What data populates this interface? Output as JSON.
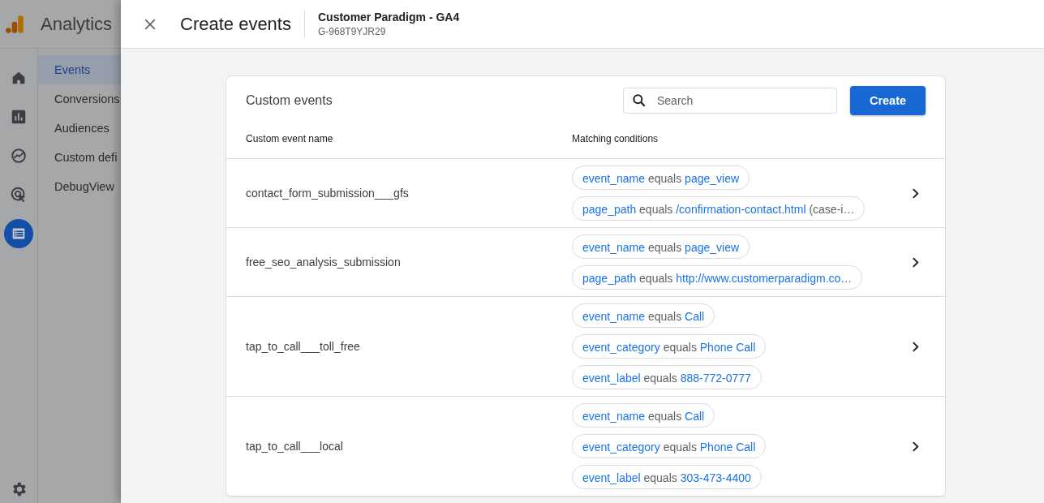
{
  "app": {
    "title": "Analytics",
    "rail": [
      {
        "selected": false
      },
      {
        "selected": false
      },
      {
        "selected": false
      },
      {
        "selected": false
      },
      {
        "selected": true
      }
    ],
    "nav": [
      {
        "label": "Events",
        "selected": true
      },
      {
        "label": "Conversions",
        "selected": false
      },
      {
        "label": "Audiences",
        "selected": false
      },
      {
        "label": "Custom defi",
        "selected": false
      },
      {
        "label": "DebugView",
        "selected": false
      }
    ]
  },
  "panel": {
    "title": "Create events",
    "property": "Customer Paradigm - GA4",
    "property_id": "G-968T9YJR29"
  },
  "card": {
    "title": "Custom events",
    "search": {
      "placeholder": "Search"
    },
    "create_button": "Create",
    "columns": [
      "Custom event name",
      "Matching conditions"
    ],
    "rows": [
      {
        "name": "contact_form_submission___gfs",
        "conditions": [
          {
            "field": "event_name",
            "operator": "equals",
            "value": "page_view"
          },
          {
            "field": "page_path",
            "operator": "equals",
            "value": "/confirmation-contact.html",
            "suffix": "(case-i…"
          }
        ]
      },
      {
        "name": "free_seo_analysis_submission",
        "conditions": [
          {
            "field": "event_name",
            "operator": "equals",
            "value": "page_view"
          },
          {
            "field": "page_path",
            "operator": "equals",
            "value": "http://www.customerparadigm.co…"
          }
        ]
      },
      {
        "name": "tap_to_call___toll_free",
        "conditions": [
          {
            "field": "event_name",
            "operator": "equals",
            "value": "Call"
          },
          {
            "field": "event_category",
            "operator": "equals",
            "value": "Phone Call"
          },
          {
            "field": "event_label",
            "operator": "equals",
            "value": "888-772-0777"
          }
        ]
      },
      {
        "name": "tap_to_call___local",
        "conditions": [
          {
            "field": "event_name",
            "operator": "equals",
            "value": "Call"
          },
          {
            "field": "event_category",
            "operator": "equals",
            "value": "Phone Call"
          },
          {
            "field": "event_label",
            "operator": "equals",
            "value": "303-473-4400"
          }
        ]
      }
    ]
  }
}
